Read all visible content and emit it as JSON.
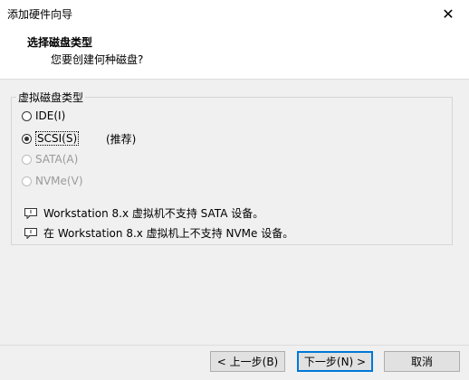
{
  "window": {
    "title": "添加硬件向导",
    "close_glyph": "✕"
  },
  "header": {
    "title": "选择磁盘类型",
    "subtitle": "您要创建何种磁盘?"
  },
  "group": {
    "label": "虚拟磁盘类型"
  },
  "options": [
    {
      "label": "IDE(I)",
      "checked": false,
      "disabled": false
    },
    {
      "label": "SCSI(S)",
      "checked": true,
      "disabled": false
    },
    {
      "label": "SATA(A)",
      "checked": false,
      "disabled": true
    },
    {
      "label": "NVMe(V)",
      "checked": false,
      "disabled": true
    }
  ],
  "recommend": "(推荐)",
  "notes": [
    "Workstation 8.x 虚拟机不支持 SATA 设备。",
    "在 Workstation 8.x 虚拟机上不支持 NVMe 设备。"
  ],
  "buttons": {
    "back": "< 上一步(B)",
    "next": "下一步(N) >",
    "cancel": "取消"
  }
}
